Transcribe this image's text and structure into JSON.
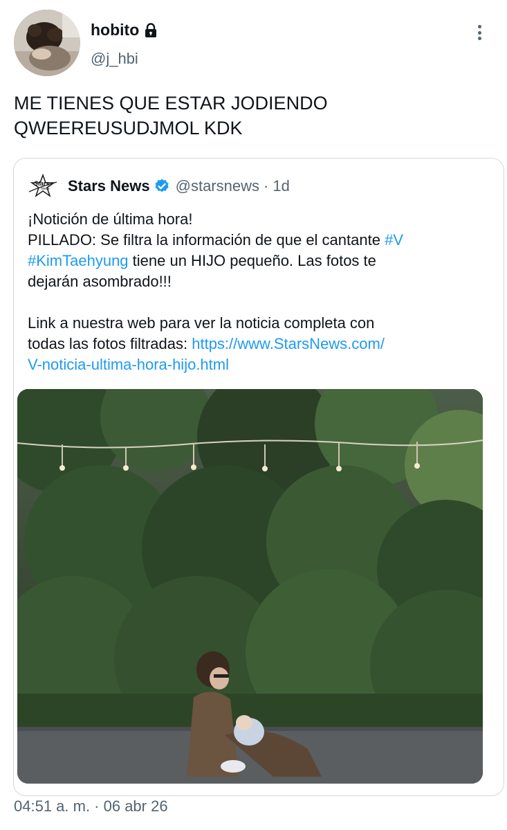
{
  "author": {
    "display_name": "hobito",
    "handle": "@j_hbi",
    "avatar_icon": "avatar-photo",
    "lock_icon": "lock-icon"
  },
  "tweet": {
    "text": "ME TIENES QUE ESTAR JODIENDO\nQWEEREUSUDJMOL KDK",
    "timestamp": "04:51 a. m. · 06 abr 26"
  },
  "quote": {
    "logo_text": "Stars",
    "logo_subtext": "News",
    "name": "Stars News",
    "verified_icon": "verified-badge-icon",
    "handle": "@starsnews",
    "separator": "·",
    "time": "1d",
    "body": {
      "line1": "¡Notición de última hora!",
      "line2_prefix": "PILLADO: Se filtra la información de que el cantante ",
      "hashtag_v": "#V",
      "hashtag_kim": "#KimTaehyung",
      "line3_suffix": " tiene un HIJO pequeño. Las fotos te",
      "line4": "dejarán asombrado!!!",
      "line5": "Link a nuestra web para ver la noticia completa con",
      "line6_prefix": "todas las fotos filtradas: ",
      "link_part1": "https://www.StarsNews.com/",
      "link_part2": "V-noticia-ultima-hora-hijo.html"
    },
    "media_description_icon": "photo-media"
  },
  "colors": {
    "accent": "#1d9bf0",
    "text_primary": "#0f1419",
    "text_secondary": "#536471",
    "border": "#cfd9de"
  }
}
